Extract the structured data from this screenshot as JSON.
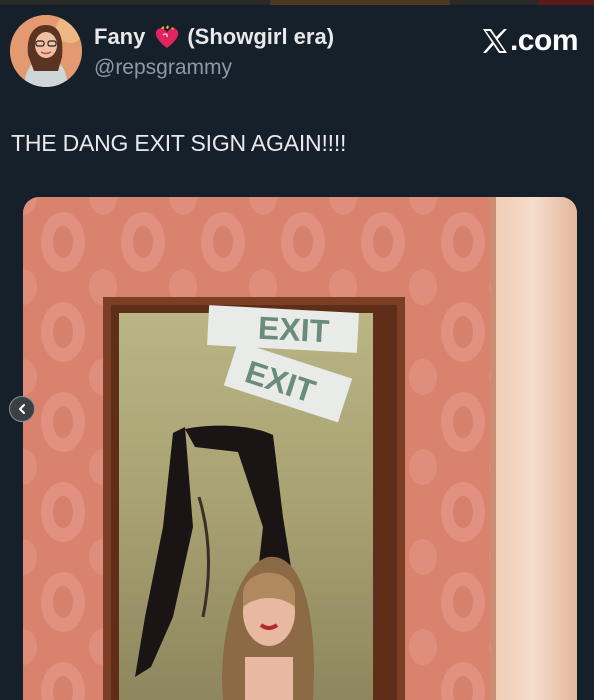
{
  "tweet": {
    "display_name": "Fany",
    "name_emoji": "heart-on-fire",
    "display_name_suffix": "(Showgirl era)",
    "handle": "@repsgrammy",
    "text": "THE DANG EXIT SIGN AGAIN!!!!"
  },
  "brand": {
    "label": ".com",
    "icon": "x-logo-icon"
  },
  "media": {
    "exit_sign_1": "EXIT",
    "exit_sign_2": "EXIT"
  },
  "carousel": {
    "prev_icon": "chevron-left-icon"
  },
  "colors": {
    "background": "#15202b",
    "text_primary": "#e7e9ea",
    "text_secondary": "#8b98a5",
    "wallpaper": "#d9826e",
    "frame": "#7a3f24"
  }
}
